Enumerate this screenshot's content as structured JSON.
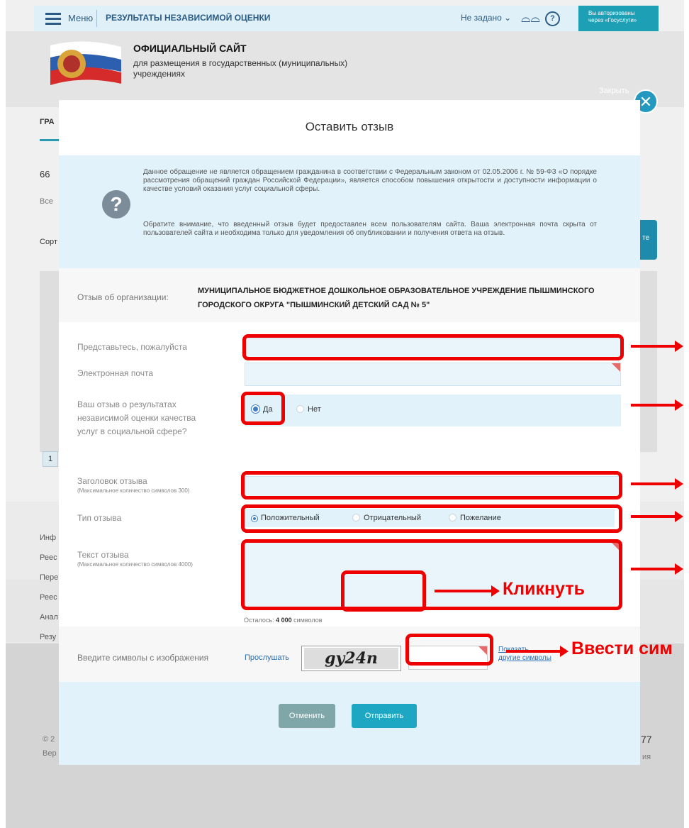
{
  "background": {
    "menu_label": "Меню",
    "page_title": "РЕЗУЛЬТАТЫ НЕЗАВИСИМОЙ ОЦЕНКИ",
    "not_set": "Не задано ⌄",
    "auth_line1": "Вы авторизованы",
    "auth_line2": "через «Госуслуги»",
    "site_name": "ОФИЦИАЛЬНЫЙ САЙТ",
    "site_sub": "для размещения в государственных (муниципальных) учреждениях",
    "tab_partial": "ГРА",
    "left_texts": [
      "66",
      "Все",
      "Сорт",
      "1",
      "Инф",
      "Реес",
      "Пере",
      "Реес",
      "Анал",
      "Резу"
    ],
    "right_texts": [
      "77",
      "ия"
    ],
    "button_partial": "те",
    "footer_partial": [
      "© 2",
      "Вер"
    ]
  },
  "close": {
    "label": "Закрыть",
    "icon": "✕"
  },
  "modal": {
    "title": "Оставить отзыв",
    "notice_p1": "Данное обращение не является обращением гражданина в соответствии с Федеральным законом от 02.05.2006 г. № 59-ФЗ «О порядке рассмотрения обращений граждан Российской Федерации», является способом повышения открытости и доступности информации о качестве условий оказания услуг социальной сферы.",
    "notice_p2": "Обратите внимание, что введенный отзыв будет предоставлен всем пользователям сайта. Ваша электронная почта скрыта от пользователей сайта и необходима только для уведомления об опубликовании и получения ответа на отзыв.",
    "org_label": "Отзыв об организации:",
    "org_value": "МУНИЦИПАЛЬНОЕ БЮДЖЕТНОЕ ДОШКОЛЬНОЕ ОБРАЗОВАТЕЛЬНОЕ УЧРЕЖДЕНИЕ ПЫШМИНСКОГО ГОРОДСКОГО ОКРУГА \"ПЫШМИНСКИЙ ДЕТСКИЙ САД № 5\"",
    "fields": {
      "name_label": "Представьтесь, пожалуйста",
      "email_label": "Электронная почта",
      "ind_label": "Ваш отзыв о результатах независимой оценки качества услуг в социальной сфере?",
      "ind_yes": "Да",
      "ind_no": "Нет",
      "title_label": "Заголовок отзыва",
      "title_hint": "(Максимальное количество символов 300)",
      "type_label": "Тип отзыва",
      "type_positive": "Положительный",
      "type_negative": "Отрицательный",
      "type_wish": "Пожелание",
      "text_label": "Текст отзыва",
      "text_hint": "(Максимальное количество символов 4000)",
      "remain_prefix": "Осталось:",
      "remain_count": "4 000",
      "remain_suffix": "символов"
    },
    "captcha": {
      "label": "Введите символы с изображения",
      "listen": "Прослушать",
      "image_text": "gy24n",
      "show_line1": "Показать",
      "show_line2": "другие символы"
    },
    "buttons": {
      "cancel": "Отменить",
      "submit": "Отправить"
    }
  },
  "annotations": {
    "captcha_hint": "Ввести сим",
    "click_hint": "Кликнуть",
    "color": "#ee0000"
  }
}
